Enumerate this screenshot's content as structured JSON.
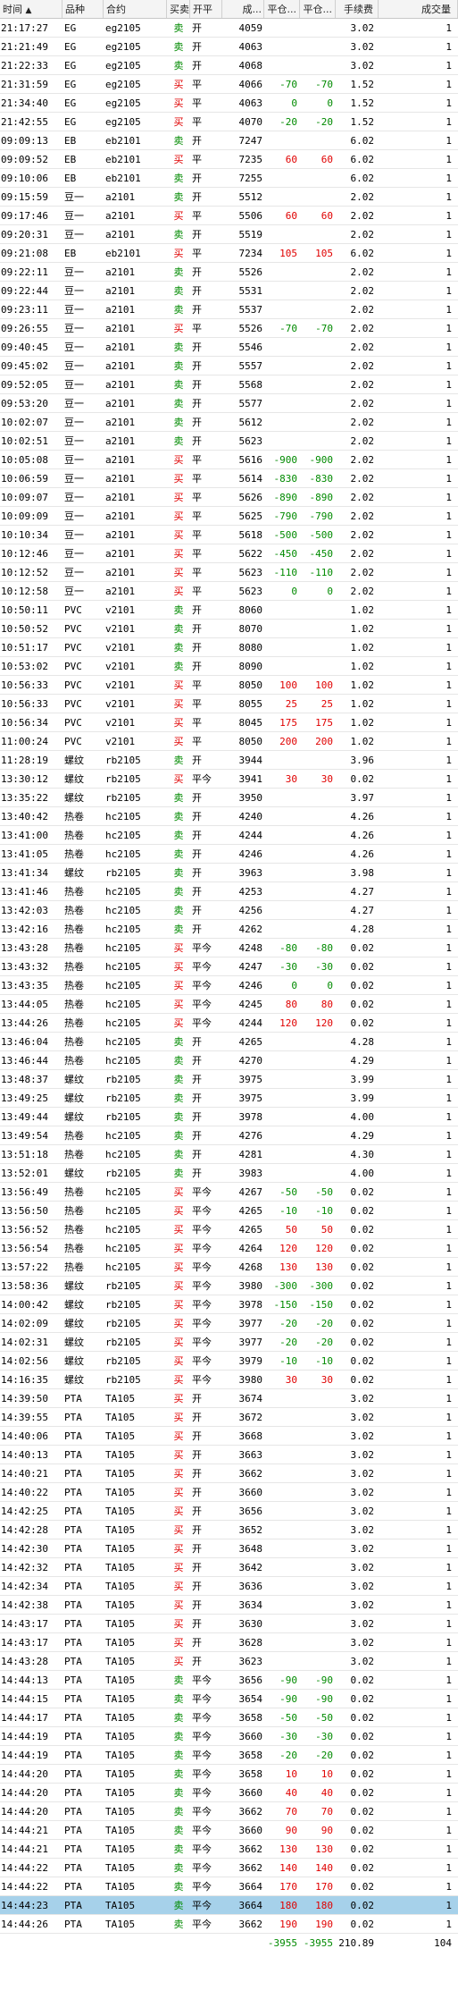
{
  "columns": {
    "time": "时间",
    "name": "品种",
    "code": "合约",
    "bs": "买卖",
    "oc": "开平",
    "price": "成...",
    "pnl1": "平仓...",
    "pnl2": "平仓...",
    "fee": "手续费",
    "vol": "成交量",
    "sort_icon": "▲"
  },
  "rows": [
    [
      "21:17:27",
      "EG",
      "eg2105",
      "卖",
      "开",
      "4059",
      "",
      "",
      "3.02",
      "1"
    ],
    [
      "21:21:49",
      "EG",
      "eg2105",
      "卖",
      "开",
      "4063",
      "",
      "",
      "3.02",
      "1"
    ],
    [
      "21:22:33",
      "EG",
      "eg2105",
      "卖",
      "开",
      "4068",
      "",
      "",
      "3.02",
      "1"
    ],
    [
      "21:31:59",
      "EG",
      "eg2105",
      "买",
      "平",
      "4066",
      "-70",
      "-70",
      "1.52",
      "1"
    ],
    [
      "21:34:40",
      "EG",
      "eg2105",
      "买",
      "平",
      "4063",
      "0",
      "0",
      "1.52",
      "1"
    ],
    [
      "21:42:55",
      "EG",
      "eg2105",
      "买",
      "平",
      "4070",
      "-20",
      "-20",
      "1.52",
      "1"
    ],
    [
      "09:09:13",
      "EB",
      "eb2101",
      "卖",
      "开",
      "7247",
      "",
      "",
      "6.02",
      "1"
    ],
    [
      "09:09:52",
      "EB",
      "eb2101",
      "买",
      "平",
      "7235",
      "60",
      "60",
      "6.02",
      "1"
    ],
    [
      "09:10:06",
      "EB",
      "eb2101",
      "卖",
      "开",
      "7255",
      "",
      "",
      "6.02",
      "1"
    ],
    [
      "09:15:59",
      "豆一",
      "a2101",
      "卖",
      "开",
      "5512",
      "",
      "",
      "2.02",
      "1"
    ],
    [
      "09:17:46",
      "豆一",
      "a2101",
      "买",
      "平",
      "5506",
      "60",
      "60",
      "2.02",
      "1"
    ],
    [
      "09:20:31",
      "豆一",
      "a2101",
      "卖",
      "开",
      "5519",
      "",
      "",
      "2.02",
      "1"
    ],
    [
      "09:21:08",
      "EB",
      "eb2101",
      "买",
      "平",
      "7234",
      "105",
      "105",
      "6.02",
      "1"
    ],
    [
      "09:22:11",
      "豆一",
      "a2101",
      "卖",
      "开",
      "5526",
      "",
      "",
      "2.02",
      "1"
    ],
    [
      "09:22:44",
      "豆一",
      "a2101",
      "卖",
      "开",
      "5531",
      "",
      "",
      "2.02",
      "1"
    ],
    [
      "09:23:11",
      "豆一",
      "a2101",
      "卖",
      "开",
      "5537",
      "",
      "",
      "2.02",
      "1"
    ],
    [
      "09:26:55",
      "豆一",
      "a2101",
      "买",
      "平",
      "5526",
      "-70",
      "-70",
      "2.02",
      "1"
    ],
    [
      "09:40:45",
      "豆一",
      "a2101",
      "卖",
      "开",
      "5546",
      "",
      "",
      "2.02",
      "1"
    ],
    [
      "09:45:02",
      "豆一",
      "a2101",
      "卖",
      "开",
      "5557",
      "",
      "",
      "2.02",
      "1"
    ],
    [
      "09:52:05",
      "豆一",
      "a2101",
      "卖",
      "开",
      "5568",
      "",
      "",
      "2.02",
      "1"
    ],
    [
      "09:53:20",
      "豆一",
      "a2101",
      "卖",
      "开",
      "5577",
      "",
      "",
      "2.02",
      "1"
    ],
    [
      "10:02:07",
      "豆一",
      "a2101",
      "卖",
      "开",
      "5612",
      "",
      "",
      "2.02",
      "1"
    ],
    [
      "10:02:51",
      "豆一",
      "a2101",
      "卖",
      "开",
      "5623",
      "",
      "",
      "2.02",
      "1"
    ],
    [
      "10:05:08",
      "豆一",
      "a2101",
      "买",
      "平",
      "5616",
      "-900",
      "-900",
      "2.02",
      "1"
    ],
    [
      "10:06:59",
      "豆一",
      "a2101",
      "买",
      "平",
      "5614",
      "-830",
      "-830",
      "2.02",
      "1"
    ],
    [
      "10:09:07",
      "豆一",
      "a2101",
      "买",
      "平",
      "5626",
      "-890",
      "-890",
      "2.02",
      "1"
    ],
    [
      "10:09:09",
      "豆一",
      "a2101",
      "买",
      "平",
      "5625",
      "-790",
      "-790",
      "2.02",
      "1"
    ],
    [
      "10:10:34",
      "豆一",
      "a2101",
      "买",
      "平",
      "5618",
      "-500",
      "-500",
      "2.02",
      "1"
    ],
    [
      "10:12:46",
      "豆一",
      "a2101",
      "买",
      "平",
      "5622",
      "-450",
      "-450",
      "2.02",
      "1"
    ],
    [
      "10:12:52",
      "豆一",
      "a2101",
      "买",
      "平",
      "5623",
      "-110",
      "-110",
      "2.02",
      "1"
    ],
    [
      "10:12:58",
      "豆一",
      "a2101",
      "买",
      "平",
      "5623",
      "0",
      "0",
      "2.02",
      "1"
    ],
    [
      "10:50:11",
      "PVC",
      "v2101",
      "卖",
      "开",
      "8060",
      "",
      "",
      "1.02",
      "1"
    ],
    [
      "10:50:52",
      "PVC",
      "v2101",
      "卖",
      "开",
      "8070",
      "",
      "",
      "1.02",
      "1"
    ],
    [
      "10:51:17",
      "PVC",
      "v2101",
      "卖",
      "开",
      "8080",
      "",
      "",
      "1.02",
      "1"
    ],
    [
      "10:53:02",
      "PVC",
      "v2101",
      "卖",
      "开",
      "8090",
      "",
      "",
      "1.02",
      "1"
    ],
    [
      "10:56:33",
      "PVC",
      "v2101",
      "买",
      "平",
      "8050",
      "100",
      "100",
      "1.02",
      "1"
    ],
    [
      "10:56:33",
      "PVC",
      "v2101",
      "买",
      "平",
      "8055",
      "25",
      "25",
      "1.02",
      "1"
    ],
    [
      "10:56:34",
      "PVC",
      "v2101",
      "买",
      "平",
      "8045",
      "175",
      "175",
      "1.02",
      "1"
    ],
    [
      "11:00:24",
      "PVC",
      "v2101",
      "买",
      "平",
      "8050",
      "200",
      "200",
      "1.02",
      "1"
    ],
    [
      "11:28:19",
      "螺纹",
      "rb2105",
      "卖",
      "开",
      "3944",
      "",
      "",
      "3.96",
      "1"
    ],
    [
      "13:30:12",
      "螺纹",
      "rb2105",
      "买",
      "平今",
      "3941",
      "30",
      "30",
      "0.02",
      "1"
    ],
    [
      "13:35:22",
      "螺纹",
      "rb2105",
      "卖",
      "开",
      "3950",
      "",
      "",
      "3.97",
      "1"
    ],
    [
      "13:40:42",
      "热卷",
      "hc2105",
      "卖",
      "开",
      "4240",
      "",
      "",
      "4.26",
      "1"
    ],
    [
      "13:41:00",
      "热卷",
      "hc2105",
      "卖",
      "开",
      "4244",
      "",
      "",
      "4.26",
      "1"
    ],
    [
      "13:41:05",
      "热卷",
      "hc2105",
      "卖",
      "开",
      "4246",
      "",
      "",
      "4.26",
      "1"
    ],
    [
      "13:41:34",
      "螺纹",
      "rb2105",
      "卖",
      "开",
      "3963",
      "",
      "",
      "3.98",
      "1"
    ],
    [
      "13:41:46",
      "热卷",
      "hc2105",
      "卖",
      "开",
      "4253",
      "",
      "",
      "4.27",
      "1"
    ],
    [
      "13:42:03",
      "热卷",
      "hc2105",
      "卖",
      "开",
      "4256",
      "",
      "",
      "4.27",
      "1"
    ],
    [
      "13:42:16",
      "热卷",
      "hc2105",
      "卖",
      "开",
      "4262",
      "",
      "",
      "4.28",
      "1"
    ],
    [
      "13:43:28",
      "热卷",
      "hc2105",
      "买",
      "平今",
      "4248",
      "-80",
      "-80",
      "0.02",
      "1"
    ],
    [
      "13:43:32",
      "热卷",
      "hc2105",
      "买",
      "平今",
      "4247",
      "-30",
      "-30",
      "0.02",
      "1"
    ],
    [
      "13:43:35",
      "热卷",
      "hc2105",
      "买",
      "平今",
      "4246",
      "0",
      "0",
      "0.02",
      "1"
    ],
    [
      "13:44:05",
      "热卷",
      "hc2105",
      "买",
      "平今",
      "4245",
      "80",
      "80",
      "0.02",
      "1"
    ],
    [
      "13:44:26",
      "热卷",
      "hc2105",
      "买",
      "平今",
      "4244",
      "120",
      "120",
      "0.02",
      "1"
    ],
    [
      "13:46:04",
      "热卷",
      "hc2105",
      "卖",
      "开",
      "4265",
      "",
      "",
      "4.28",
      "1"
    ],
    [
      "13:46:44",
      "热卷",
      "hc2105",
      "卖",
      "开",
      "4270",
      "",
      "",
      "4.29",
      "1"
    ],
    [
      "13:48:37",
      "螺纹",
      "rb2105",
      "卖",
      "开",
      "3975",
      "",
      "",
      "3.99",
      "1"
    ],
    [
      "13:49:25",
      "螺纹",
      "rb2105",
      "卖",
      "开",
      "3975",
      "",
      "",
      "3.99",
      "1"
    ],
    [
      "13:49:44",
      "螺纹",
      "rb2105",
      "卖",
      "开",
      "3978",
      "",
      "",
      "4.00",
      "1"
    ],
    [
      "13:49:54",
      "热卷",
      "hc2105",
      "卖",
      "开",
      "4276",
      "",
      "",
      "4.29",
      "1"
    ],
    [
      "13:51:18",
      "热卷",
      "hc2105",
      "卖",
      "开",
      "4281",
      "",
      "",
      "4.30",
      "1"
    ],
    [
      "13:52:01",
      "螺纹",
      "rb2105",
      "卖",
      "开",
      "3983",
      "",
      "",
      "4.00",
      "1"
    ],
    [
      "13:56:49",
      "热卷",
      "hc2105",
      "买",
      "平今",
      "4267",
      "-50",
      "-50",
      "0.02",
      "1"
    ],
    [
      "13:56:50",
      "热卷",
      "hc2105",
      "买",
      "平今",
      "4265",
      "-10",
      "-10",
      "0.02",
      "1"
    ],
    [
      "13:56:52",
      "热卷",
      "hc2105",
      "买",
      "平今",
      "4265",
      "50",
      "50",
      "0.02",
      "1"
    ],
    [
      "13:56:54",
      "热卷",
      "hc2105",
      "买",
      "平今",
      "4264",
      "120",
      "120",
      "0.02",
      "1"
    ],
    [
      "13:57:22",
      "热卷",
      "hc2105",
      "买",
      "平今",
      "4268",
      "130",
      "130",
      "0.02",
      "1"
    ],
    [
      "13:58:36",
      "螺纹",
      "rb2105",
      "买",
      "平今",
      "3980",
      "-300",
      "-300",
      "0.02",
      "1"
    ],
    [
      "14:00:42",
      "螺纹",
      "rb2105",
      "买",
      "平今",
      "3978",
      "-150",
      "-150",
      "0.02",
      "1"
    ],
    [
      "14:02:09",
      "螺纹",
      "rb2105",
      "买",
      "平今",
      "3977",
      "-20",
      "-20",
      "0.02",
      "1"
    ],
    [
      "14:02:31",
      "螺纹",
      "rb2105",
      "买",
      "平今",
      "3977",
      "-20",
      "-20",
      "0.02",
      "1"
    ],
    [
      "14:02:56",
      "螺纹",
      "rb2105",
      "买",
      "平今",
      "3979",
      "-10",
      "-10",
      "0.02",
      "1"
    ],
    [
      "14:16:35",
      "螺纹",
      "rb2105",
      "买",
      "平今",
      "3980",
      "30",
      "30",
      "0.02",
      "1"
    ],
    [
      "14:39:50",
      "PTA",
      "TA105",
      "买",
      "开",
      "3674",
      "",
      "",
      "3.02",
      "1"
    ],
    [
      "14:39:55",
      "PTA",
      "TA105",
      "买",
      "开",
      "3672",
      "",
      "",
      "3.02",
      "1"
    ],
    [
      "14:40:06",
      "PTA",
      "TA105",
      "买",
      "开",
      "3668",
      "",
      "",
      "3.02",
      "1"
    ],
    [
      "14:40:13",
      "PTA",
      "TA105",
      "买",
      "开",
      "3663",
      "",
      "",
      "3.02",
      "1"
    ],
    [
      "14:40:21",
      "PTA",
      "TA105",
      "买",
      "开",
      "3662",
      "",
      "",
      "3.02",
      "1"
    ],
    [
      "14:40:22",
      "PTA",
      "TA105",
      "买",
      "开",
      "3660",
      "",
      "",
      "3.02",
      "1"
    ],
    [
      "14:42:25",
      "PTA",
      "TA105",
      "买",
      "开",
      "3656",
      "",
      "",
      "3.02",
      "1"
    ],
    [
      "14:42:28",
      "PTA",
      "TA105",
      "买",
      "开",
      "3652",
      "",
      "",
      "3.02",
      "1"
    ],
    [
      "14:42:30",
      "PTA",
      "TA105",
      "买",
      "开",
      "3648",
      "",
      "",
      "3.02",
      "1"
    ],
    [
      "14:42:32",
      "PTA",
      "TA105",
      "买",
      "开",
      "3642",
      "",
      "",
      "3.02",
      "1"
    ],
    [
      "14:42:34",
      "PTA",
      "TA105",
      "买",
      "开",
      "3636",
      "",
      "",
      "3.02",
      "1"
    ],
    [
      "14:42:38",
      "PTA",
      "TA105",
      "买",
      "开",
      "3634",
      "",
      "",
      "3.02",
      "1"
    ],
    [
      "14:43:17",
      "PTA",
      "TA105",
      "买",
      "开",
      "3630",
      "",
      "",
      "3.02",
      "1"
    ],
    [
      "14:43:17",
      "PTA",
      "TA105",
      "买",
      "开",
      "3628",
      "",
      "",
      "3.02",
      "1"
    ],
    [
      "14:43:28",
      "PTA",
      "TA105",
      "买",
      "开",
      "3623",
      "",
      "",
      "3.02",
      "1"
    ],
    [
      "14:44:13",
      "PTA",
      "TA105",
      "卖",
      "平今",
      "3656",
      "-90",
      "-90",
      "0.02",
      "1"
    ],
    [
      "14:44:15",
      "PTA",
      "TA105",
      "卖",
      "平今",
      "3654",
      "-90",
      "-90",
      "0.02",
      "1"
    ],
    [
      "14:44:17",
      "PTA",
      "TA105",
      "卖",
      "平今",
      "3658",
      "-50",
      "-50",
      "0.02",
      "1"
    ],
    [
      "14:44:19",
      "PTA",
      "TA105",
      "卖",
      "平今",
      "3660",
      "-30",
      "-30",
      "0.02",
      "1"
    ],
    [
      "14:44:19",
      "PTA",
      "TA105",
      "卖",
      "平今",
      "3658",
      "-20",
      "-20",
      "0.02",
      "1"
    ],
    [
      "14:44:20",
      "PTA",
      "TA105",
      "卖",
      "平今",
      "3658",
      "10",
      "10",
      "0.02",
      "1"
    ],
    [
      "14:44:20",
      "PTA",
      "TA105",
      "卖",
      "平今",
      "3660",
      "40",
      "40",
      "0.02",
      "1"
    ],
    [
      "14:44:20",
      "PTA",
      "TA105",
      "卖",
      "平今",
      "3662",
      "70",
      "70",
      "0.02",
      "1"
    ],
    [
      "14:44:21",
      "PTA",
      "TA105",
      "卖",
      "平今",
      "3660",
      "90",
      "90",
      "0.02",
      "1"
    ],
    [
      "14:44:21",
      "PTA",
      "TA105",
      "卖",
      "平今",
      "3662",
      "130",
      "130",
      "0.02",
      "1"
    ],
    [
      "14:44:22",
      "PTA",
      "TA105",
      "卖",
      "平今",
      "3662",
      "140",
      "140",
      "0.02",
      "1"
    ],
    [
      "14:44:22",
      "PTA",
      "TA105",
      "卖",
      "平今",
      "3664",
      "170",
      "170",
      "0.02",
      "1"
    ],
    [
      "14:44:23",
      "PTA",
      "TA105",
      "卖",
      "平今",
      "3664",
      "180",
      "180",
      "0.02",
      "1"
    ],
    [
      "14:44:26",
      "PTA",
      "TA105",
      "卖",
      "平今",
      "3662",
      "190",
      "190",
      "0.02",
      "1"
    ]
  ],
  "selected_row_index": 100,
  "footer": {
    "pnl1": "-3955",
    "pnl2": "-3955",
    "fee": "210.89",
    "vol": "104"
  },
  "colors": {
    "buy": "#e00000",
    "sell": "#008a00",
    "selected": "#a6d1ea"
  }
}
